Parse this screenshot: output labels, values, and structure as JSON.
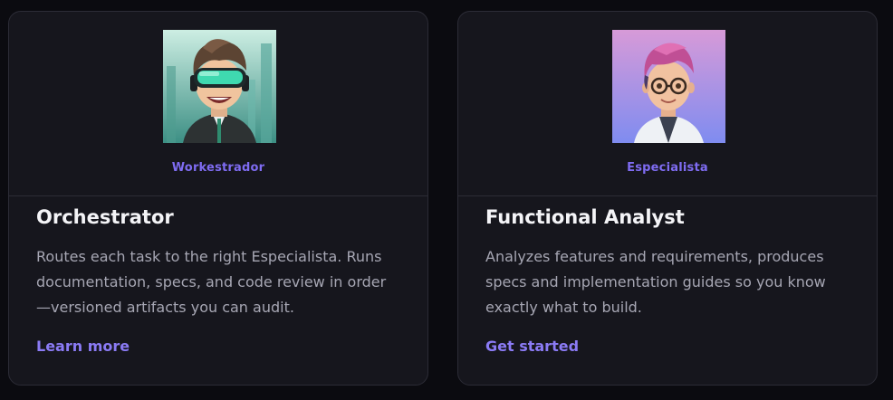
{
  "theme": {
    "accent": "#8b7bf5",
    "background": "#0b0b10",
    "card_background": "#16161d",
    "title_color": "#f4f4f7",
    "text_color": "#a6a6b3"
  },
  "cards": [
    {
      "avatar_icon": "vr-headset-person-avatar",
      "role_tag": "Workestrador",
      "title": "Orchestrator",
      "description": "Routes each task to the right Especialista. Runs documentation, specs, and code review in order—versioned artifacts you can audit.",
      "link_label": "Learn more"
    },
    {
      "avatar_icon": "glasses-scientist-avatar",
      "role_tag": "Especialista",
      "title": "Functional Analyst",
      "description": "Analyzes features and requirements, produces specs and implementation guides so you know exactly what to build.",
      "link_label": "Get started"
    }
  ]
}
